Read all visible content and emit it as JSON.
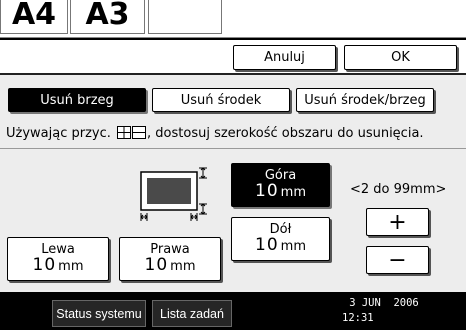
{
  "top_tiles": [
    {
      "label": "A4"
    },
    {
      "label": "A3"
    },
    {
      "label": ""
    }
  ],
  "header": {
    "cancel_label": "Anuluj",
    "ok_label": "OK"
  },
  "tabs": [
    {
      "label": "Usuń brzeg",
      "selected": true
    },
    {
      "label": "Usuń środek",
      "selected": false
    },
    {
      "label": "Usuń środek/brzeg",
      "selected": false
    }
  ],
  "instruction": {
    "before": "Używając przyc.",
    "after": ", dostosuj szerokość obszaru do usunięcia."
  },
  "margins": {
    "top": {
      "label": "Góra",
      "value": "10",
      "unit": "mm",
      "selected": true
    },
    "bottom": {
      "label": "Dół",
      "value": "10",
      "unit": "mm",
      "selected": false
    },
    "left": {
      "label": "Lewa",
      "value": "10",
      "unit": "mm",
      "selected": false
    },
    "right": {
      "label": "Prawa",
      "value": "10",
      "unit": "mm",
      "selected": false
    }
  },
  "range_text": "<2 do 99mm>",
  "stepper": {
    "plus": "+",
    "minus": "−"
  },
  "taskbar": {
    "status_label": "Status systemu",
    "jobs_label": "Lista zadań",
    "date": "3 JUN  2006",
    "time": "12:31"
  },
  "colors": {
    "selected_bg": "#000000",
    "panel_bg": "#ededed",
    "preview_fill": "#4a4a4a"
  }
}
